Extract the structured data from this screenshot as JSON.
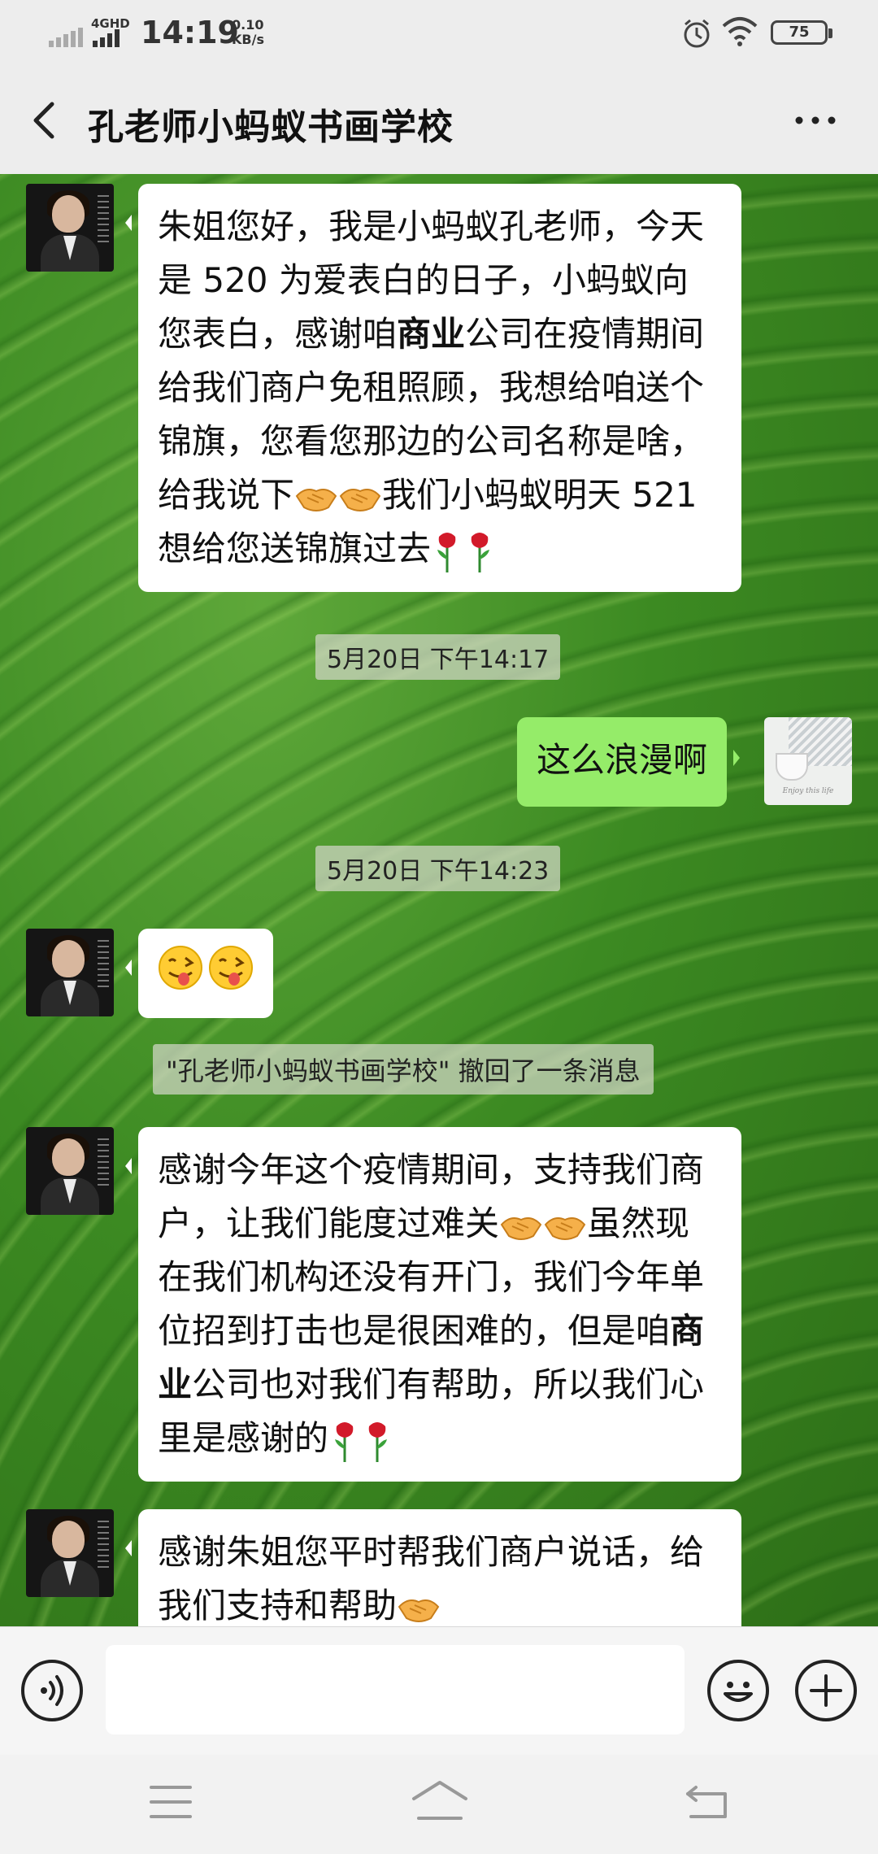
{
  "status_bar": {
    "network": "4GHD",
    "time": "14:19",
    "speed_value": "0.10",
    "speed_unit": "KB/s",
    "battery": "75"
  },
  "header": {
    "title": "孔老师小蚂蚁书画学校"
  },
  "messages": [
    {
      "side": "left",
      "pre": "朱姐您好，我是小蚂蚁孔老师，今天是 520 为爱表白的日子，小蚂蚁向您表白，感谢咱",
      "bold": "商业",
      "post": "公司在疫情期间给我们商户免租照顾，我想给咱送个锦旗，您看您那边的公司名称是啥，给我说下",
      "tail": "我们小蚂蚁明天 521 想给您送锦旗过去"
    },
    {
      "time": "5月20日 下午14:17"
    },
    {
      "side": "right",
      "text": "这么浪漫啊"
    },
    {
      "time": "5月20日 下午14:23"
    },
    {
      "side": "left",
      "emoji": "😜😜"
    },
    {
      "recall": "\"孔老师小蚂蚁书画学校\" 撤回了一条消息"
    },
    {
      "side": "left",
      "pre": "感谢今年这个疫情期间，支持我们商户，让我们能度过难关",
      "mid": "虽然现在我们机构还没有开门，我们今年单位招到打击也是很困难的，但是咱",
      "bold": "商业",
      "post": "公司也对我们有帮助，所以我们心里是感谢的"
    },
    {
      "side": "left",
      "text": "感谢朱姐您平时帮我们商户说话，给我们支持和帮助"
    }
  ],
  "self_avatar_caption": "Enjoy this life",
  "input": {
    "placeholder": ""
  },
  "icons": {
    "back": "back-arrow-icon",
    "more": "more-dots-icon",
    "voice": "voice-icon",
    "emoji": "emoji-icon",
    "plus": "plus-icon",
    "handshake": "handshake-icon",
    "rose": "rose-icon"
  },
  "colors": {
    "my_bubble": "#95ec69",
    "other_bubble": "#ffffff",
    "header_bg": "#ededed"
  }
}
